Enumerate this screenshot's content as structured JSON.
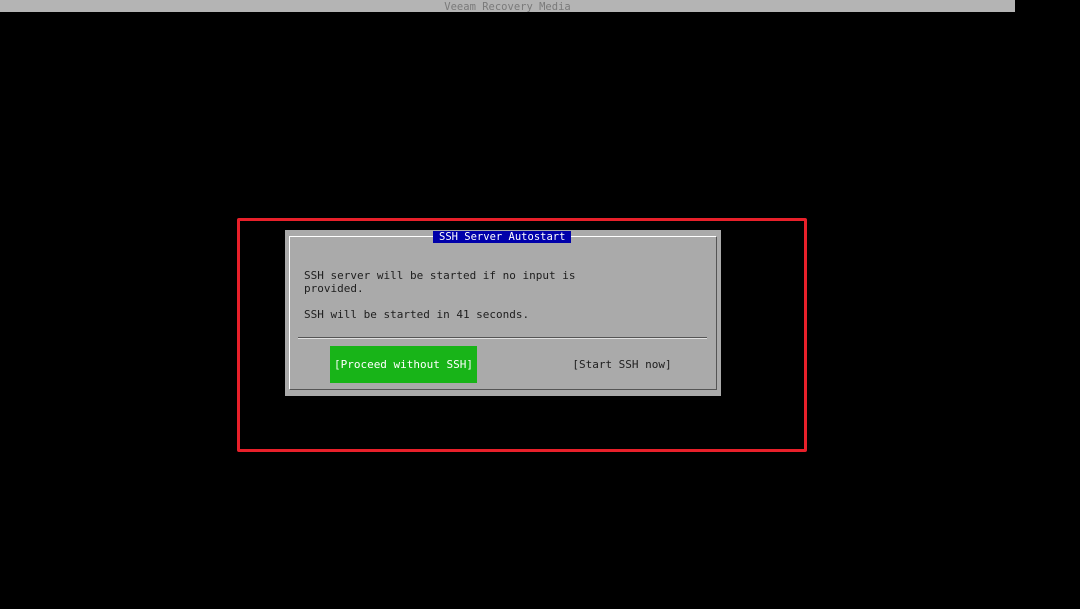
{
  "window": {
    "title": "Veeam Recovery Media"
  },
  "dialog": {
    "title": "SSH Server Autostart",
    "message_lines": [
      "SSH server will be started if no input is",
      "provided.",
      "SSH will be started in 41 seconds."
    ],
    "buttons": {
      "proceed_label": "[Proceed without SSH]",
      "start_label": "[Start SSH now]"
    }
  },
  "colors": {
    "background": "#000000",
    "title_bar": "#b4b4b4",
    "dialog_background": "#aaaaaa",
    "dialog_title_background": "#0000aa",
    "selected_button": "#18b418",
    "highlight_outline": "#e8202a"
  }
}
